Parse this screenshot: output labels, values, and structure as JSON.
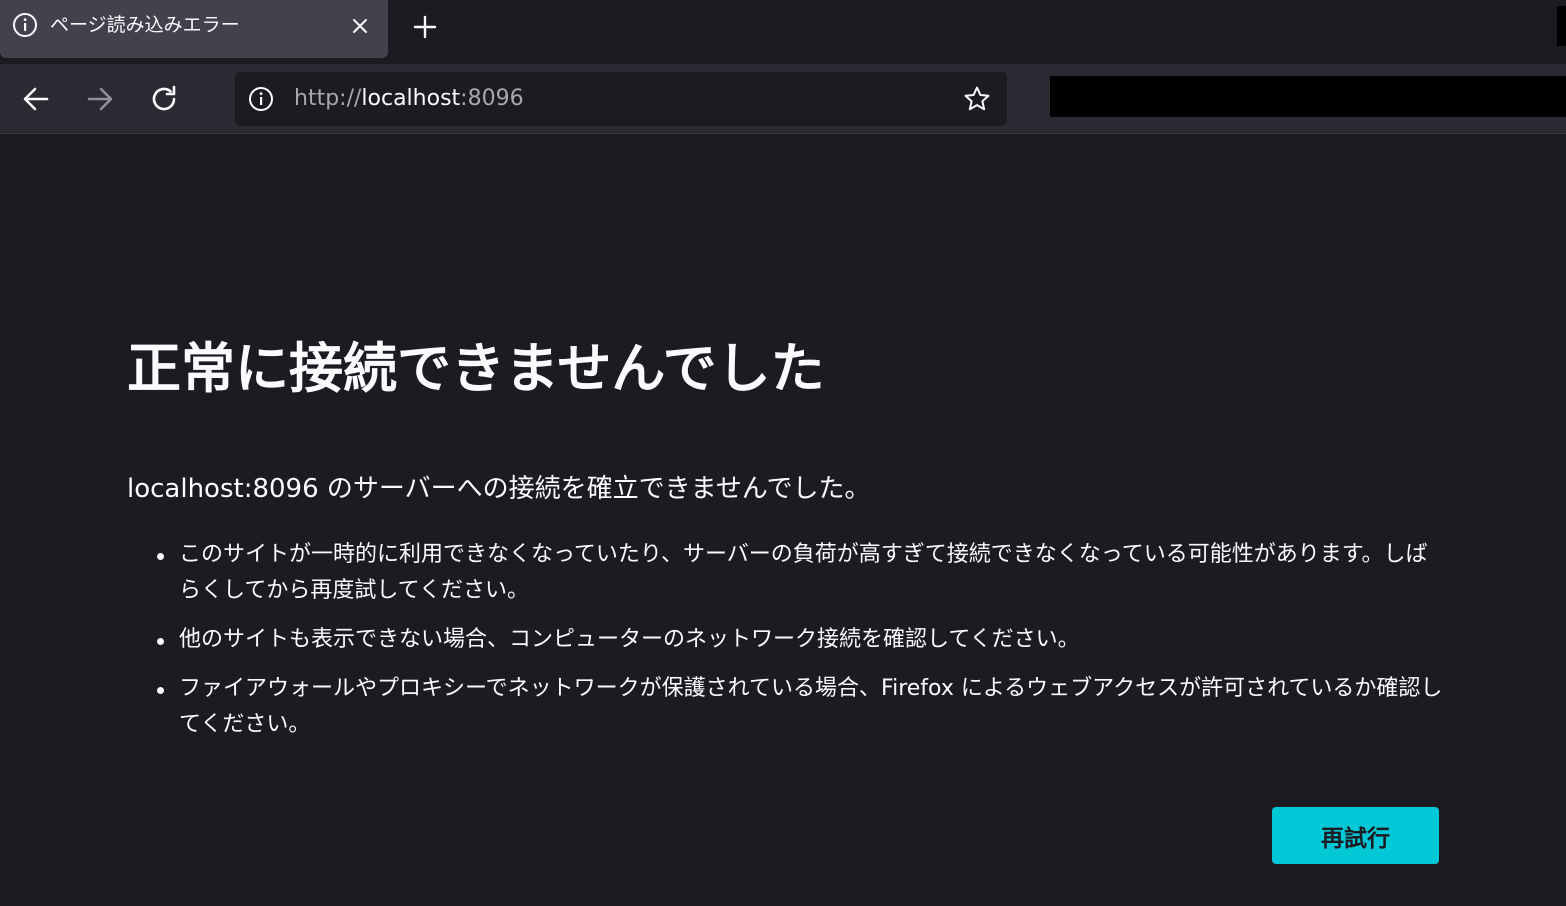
{
  "tab": {
    "title": "ページ読み込みエラー",
    "icon": "info-icon",
    "close_icon": "close-icon"
  },
  "new_tab_icon": "plus-icon",
  "nav": {
    "back_icon": "arrow-left-icon",
    "forward_icon": "arrow-right-icon",
    "reload_icon": "reload-icon"
  },
  "urlbar": {
    "icon": "info-icon",
    "scheme": "http://",
    "host": "localhost",
    "port": ":8096",
    "bookmark_icon": "star-icon"
  },
  "error": {
    "title": "正常に接続できませんでした",
    "summary": "localhost:8096 のサーバーへの接続を確立できませんでした。",
    "items": [
      "このサイトが一時的に利用できなくなっていたり、サーバーの負荷が高すぎて接続できなくなっている可能性があります。しばらくしてから再度試してください。",
      "他のサイトも表示できない場合、コンピューターのネットワーク接続を確認してください。",
      "ファイアウォールやプロキシーでネットワークが保護されている場合、Firefox によるウェブアクセスが許可されているか確認してください。"
    ],
    "retry_label": "再試行"
  },
  "colors": {
    "background": "#1c1b22",
    "toolbar": "#2b2a33",
    "active_tab": "#42414d",
    "text": "#fbfbfe",
    "accent": "#00c8d7"
  }
}
